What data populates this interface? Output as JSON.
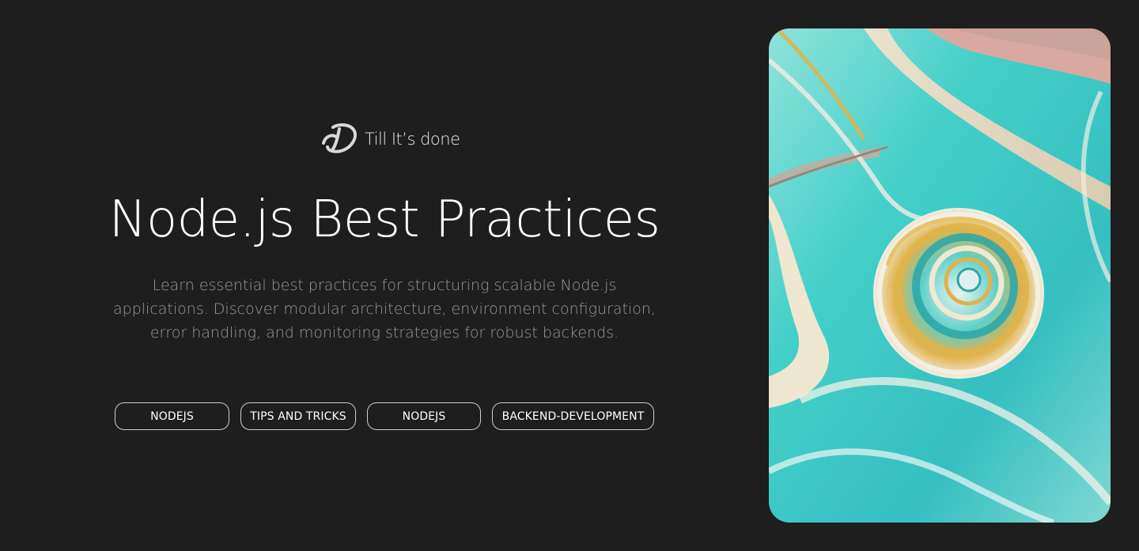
{
  "brand": {
    "name": "Till It’s done",
    "logo_icon": "td-monogram-icon"
  },
  "post": {
    "title": "Node.js Best Practices",
    "description": "Learn essential best practices for structuring scalable Node.js applications. Discover modular architecture, environment configuration, error handling, and monitoring strategies for robust backends."
  },
  "tags": [
    {
      "label": "NODEJS"
    },
    {
      "label": "TIPS AND TRICKS"
    },
    {
      "label": "NODEJS"
    },
    {
      "label": "BACKEND-DEVELOPMENT"
    }
  ],
  "hero_image": {
    "icon": "spiral-shell-landscape-image"
  },
  "colors": {
    "background": "#1e1e1e",
    "text": "#ffffff",
    "muted_text": "#9a9a9a",
    "tag_border": "#cfcfcf",
    "turquoise": "#3fd1cc",
    "gold": "#d9a93b"
  }
}
